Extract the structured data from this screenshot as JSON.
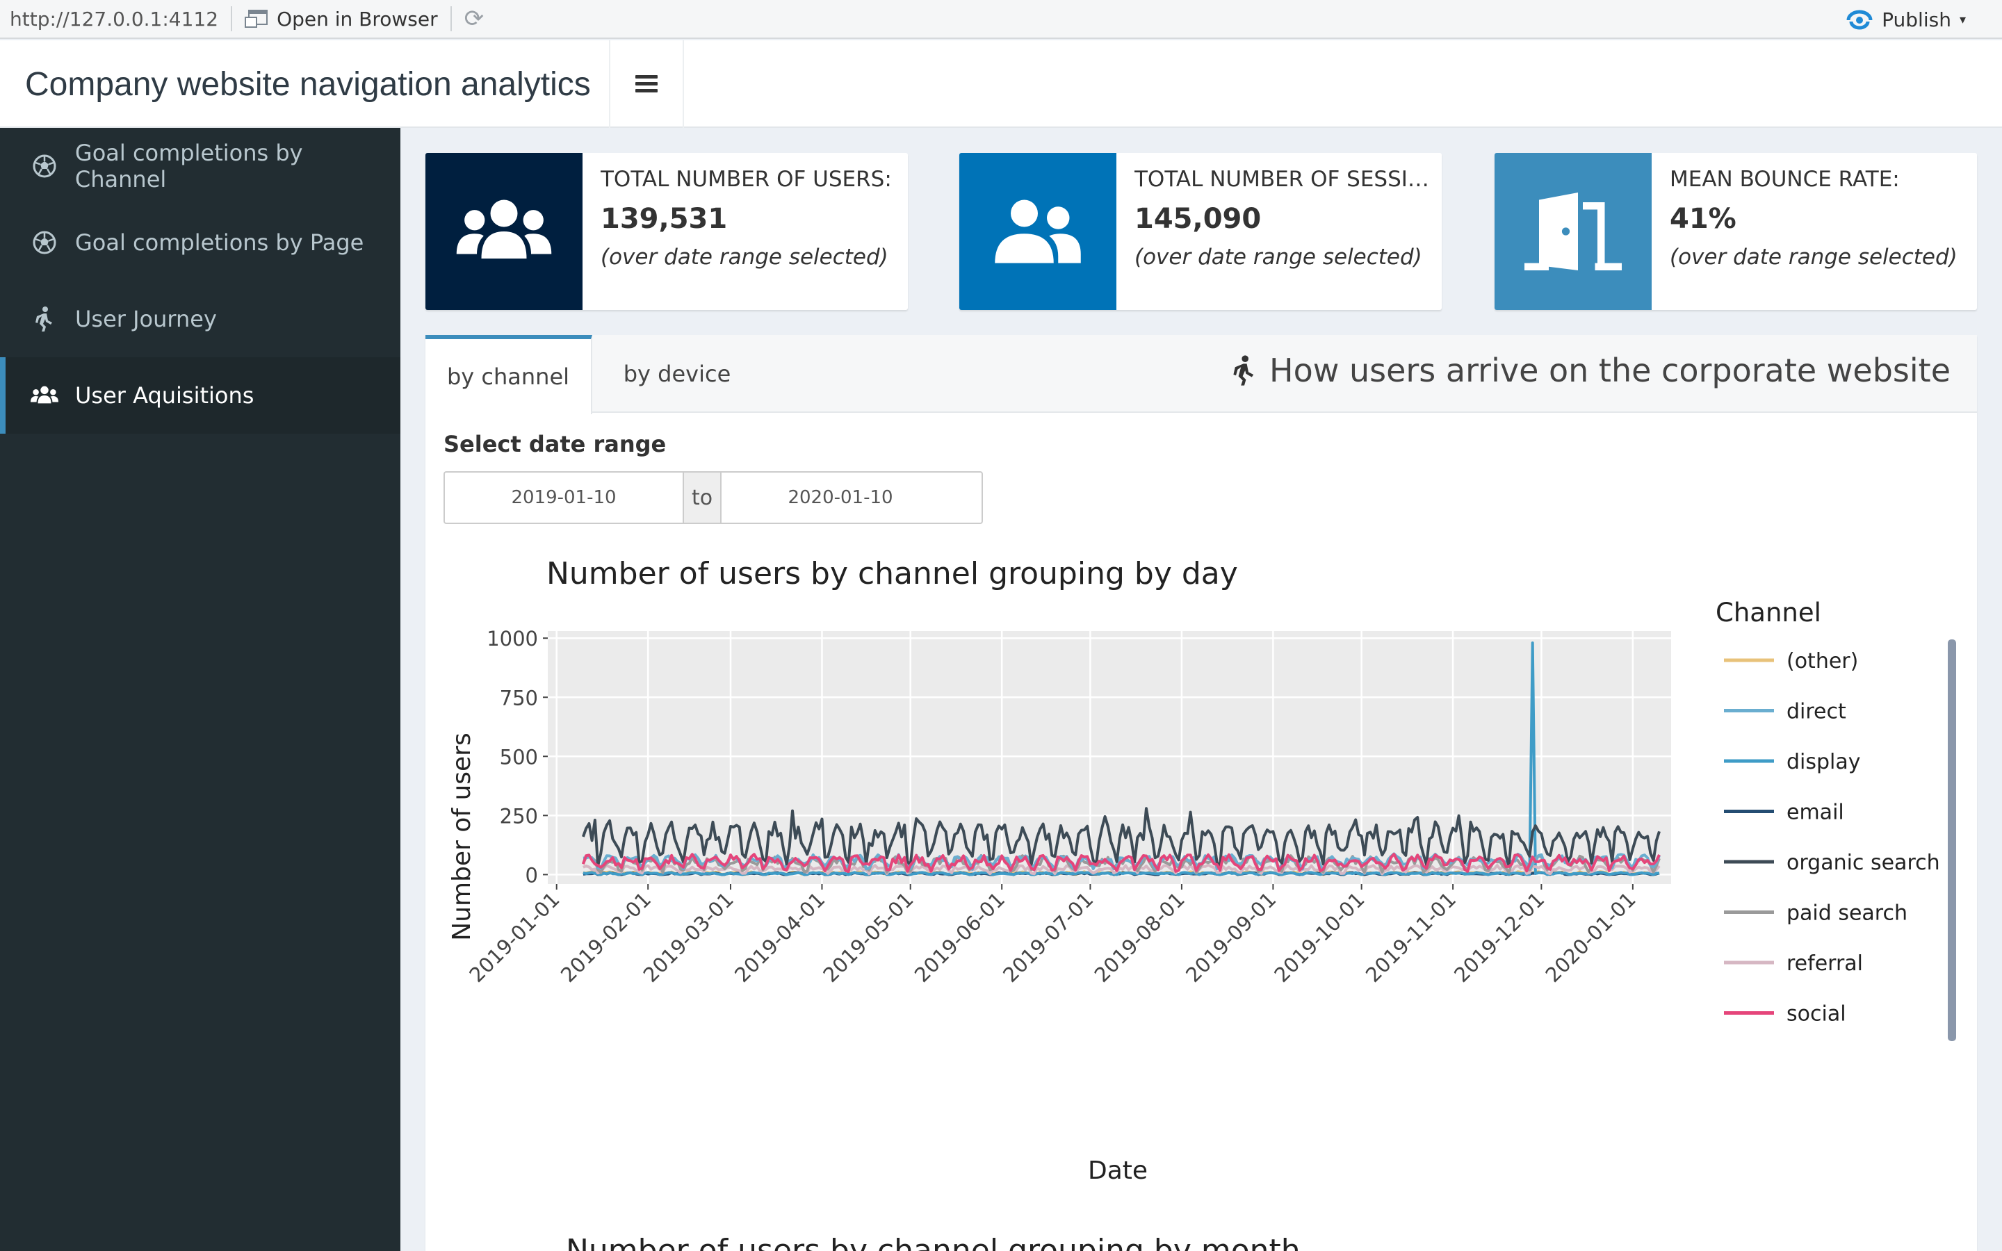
{
  "viewer": {
    "url": "http://127.0.0.1:4112",
    "open_label": "Open in Browser",
    "publish_label": "Publish"
  },
  "header": {
    "title": "Company website navigation analytics"
  },
  "sidebar": {
    "items": [
      {
        "label": "Goal completions by Channel",
        "icon": "soccer-ball-icon"
      },
      {
        "label": "Goal completions by Page",
        "icon": "soccer-ball-icon"
      },
      {
        "label": "User Journey",
        "icon": "walking-icon"
      },
      {
        "label": "User Aquisitions",
        "icon": "users-icon"
      }
    ],
    "active_index": 3
  },
  "infoboxes": [
    {
      "label": "TOTAL NUMBER OF USERS:",
      "value": "139,531",
      "sub": "(over date range selected)",
      "color": "#001f3f",
      "icon": "users-icon"
    },
    {
      "label": "TOTAL NUMBER OF SESSIO...",
      "value": "145,090",
      "sub": "(over date range selected)",
      "color": "#0073b7",
      "icon": "user-friends-icon"
    },
    {
      "label": "MEAN BOUNCE RATE:",
      "value": "41%",
      "sub": "(over date range selected)",
      "color": "#3c8dbc",
      "icon": "door-open-icon"
    }
  ],
  "tabs": {
    "items": [
      "by channel",
      "by device"
    ],
    "active_index": 0,
    "title": "How users arrive on the corporate website"
  },
  "date_range": {
    "label": "Select date range",
    "start": "2019-01-10",
    "separator": "to",
    "end": "2020-01-10"
  },
  "chart_data": {
    "type": "line",
    "title": "Number of users by channel grouping by day",
    "xlabel": "Date",
    "ylabel": "Number of users",
    "x_ticks": [
      "2019-01-01",
      "2019-02-01",
      "2019-03-01",
      "2019-04-01",
      "2019-05-01",
      "2019-06-01",
      "2019-07-01",
      "2019-08-01",
      "2019-09-01",
      "2019-10-01",
      "2019-11-01",
      "2019-12-01",
      "2020-01-01"
    ],
    "x_range": [
      "2018-12-29",
      "2020-01-14"
    ],
    "y_ticks": [
      0,
      250,
      500,
      750,
      1000
    ],
    "ylim": [
      -40,
      1030
    ],
    "grid": true,
    "legend_title": "Channel",
    "legend_position": "right",
    "date_start": "2019-01-10",
    "date_end": "2020-01-10",
    "series": [
      {
        "name": "(other)",
        "color": "#e8c27a",
        "base": 5,
        "amp": 4,
        "noise": 4
      },
      {
        "name": "direct",
        "color": "#6aaed0",
        "base": 55,
        "amp": 20,
        "noise": 15
      },
      {
        "name": "display",
        "color": "#3f9cc7",
        "base": 4,
        "amp": 3,
        "noise": 3,
        "spike_date": "2019-11-28",
        "spike_value": 980
      },
      {
        "name": "email",
        "color": "#244d72",
        "base": 3,
        "amp": 3,
        "noise": 3
      },
      {
        "name": "organic search",
        "color": "#3d4b56",
        "base": 130,
        "amp": 65,
        "noise": 35
      },
      {
        "name": "paid search",
        "color": "#9a9a9a",
        "base": 45,
        "amp": 20,
        "noise": 18
      },
      {
        "name": "referral",
        "color": "#d6b7c3",
        "base": 22,
        "amp": 10,
        "noise": 10
      },
      {
        "name": "social",
        "color": "#e5457a",
        "base": 50,
        "amp": 22,
        "noise": 18
      }
    ]
  },
  "next_chart_title": "Number of users by channel grouping by month"
}
